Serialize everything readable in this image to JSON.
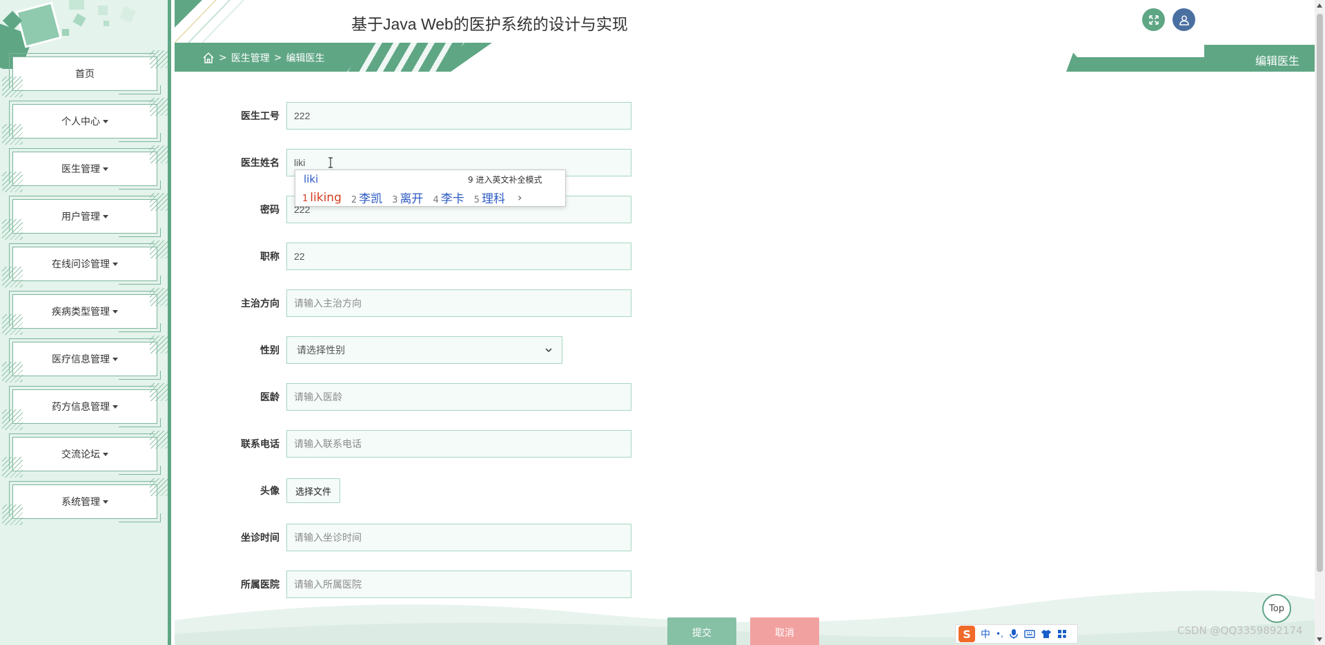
{
  "app": {
    "title": "基于Java Web的医护系统的设计与实现",
    "accent": "#5fa685",
    "user_button_color": "#4a6fa1"
  },
  "sidebar": {
    "items": [
      {
        "label": "首页",
        "dropdown": false
      },
      {
        "label": "个人中心",
        "dropdown": true
      },
      {
        "label": "医生管理",
        "dropdown": true
      },
      {
        "label": "用户管理",
        "dropdown": true
      },
      {
        "label": "在线问诊管理",
        "dropdown": true
      },
      {
        "label": "疾病类型管理",
        "dropdown": true
      },
      {
        "label": "医疗信息管理",
        "dropdown": true
      },
      {
        "label": "药方信息管理",
        "dropdown": true
      },
      {
        "label": "交流论坛",
        "dropdown": true
      },
      {
        "label": "系统管理",
        "dropdown": true
      }
    ]
  },
  "header": {
    "expand_icon": "expand-icon",
    "user_icon": "user-icon"
  },
  "breadcrumb": {
    "home_icon": "home-icon",
    "sep1": ">",
    "level1": "医生管理",
    "sep2": ">",
    "level2": "编辑医生"
  },
  "page_tag": "编辑医生",
  "form": {
    "doctor_id": {
      "label": "医生工号",
      "value": "222"
    },
    "doctor_name": {
      "label": "医生姓名",
      "value": "liki"
    },
    "password": {
      "label": "密码",
      "value": "222"
    },
    "title": {
      "label": "职称",
      "value": "22"
    },
    "specialty": {
      "label": "主治方向",
      "placeholder": "请输入主治方向"
    },
    "gender": {
      "label": "性别",
      "selected": "请选择性别"
    },
    "years": {
      "label": "医龄",
      "placeholder": "请输入医龄"
    },
    "phone": {
      "label": "联系电话",
      "placeholder": "请输入联系电话"
    },
    "avatar": {
      "label": "头像",
      "button": "选择文件"
    },
    "schedule": {
      "label": "坐诊时间",
      "placeholder": "请输入坐诊时间"
    },
    "hospital": {
      "label": "所属医院",
      "placeholder": "请输入所属医院"
    },
    "submit": "提交",
    "cancel": "取消"
  },
  "ime": {
    "composition": "liki",
    "hint": "9 进入英文补全模式",
    "candidates": [
      {
        "num": "1",
        "text": "liking"
      },
      {
        "num": "2",
        "text": "李凯"
      },
      {
        "num": "3",
        "text": "离开"
      },
      {
        "num": "4",
        "text": "李卡"
      },
      {
        "num": "5",
        "text": "理科"
      }
    ],
    "next": "›"
  },
  "ime_toolbar": {
    "logo": "S",
    "mode": "中",
    "items": [
      "•,",
      "mic-icon",
      "keyboard-icon",
      "shirt-icon",
      "grid-icon"
    ]
  },
  "top_button": "Top",
  "watermark": "CSDN @QQ3359892174"
}
